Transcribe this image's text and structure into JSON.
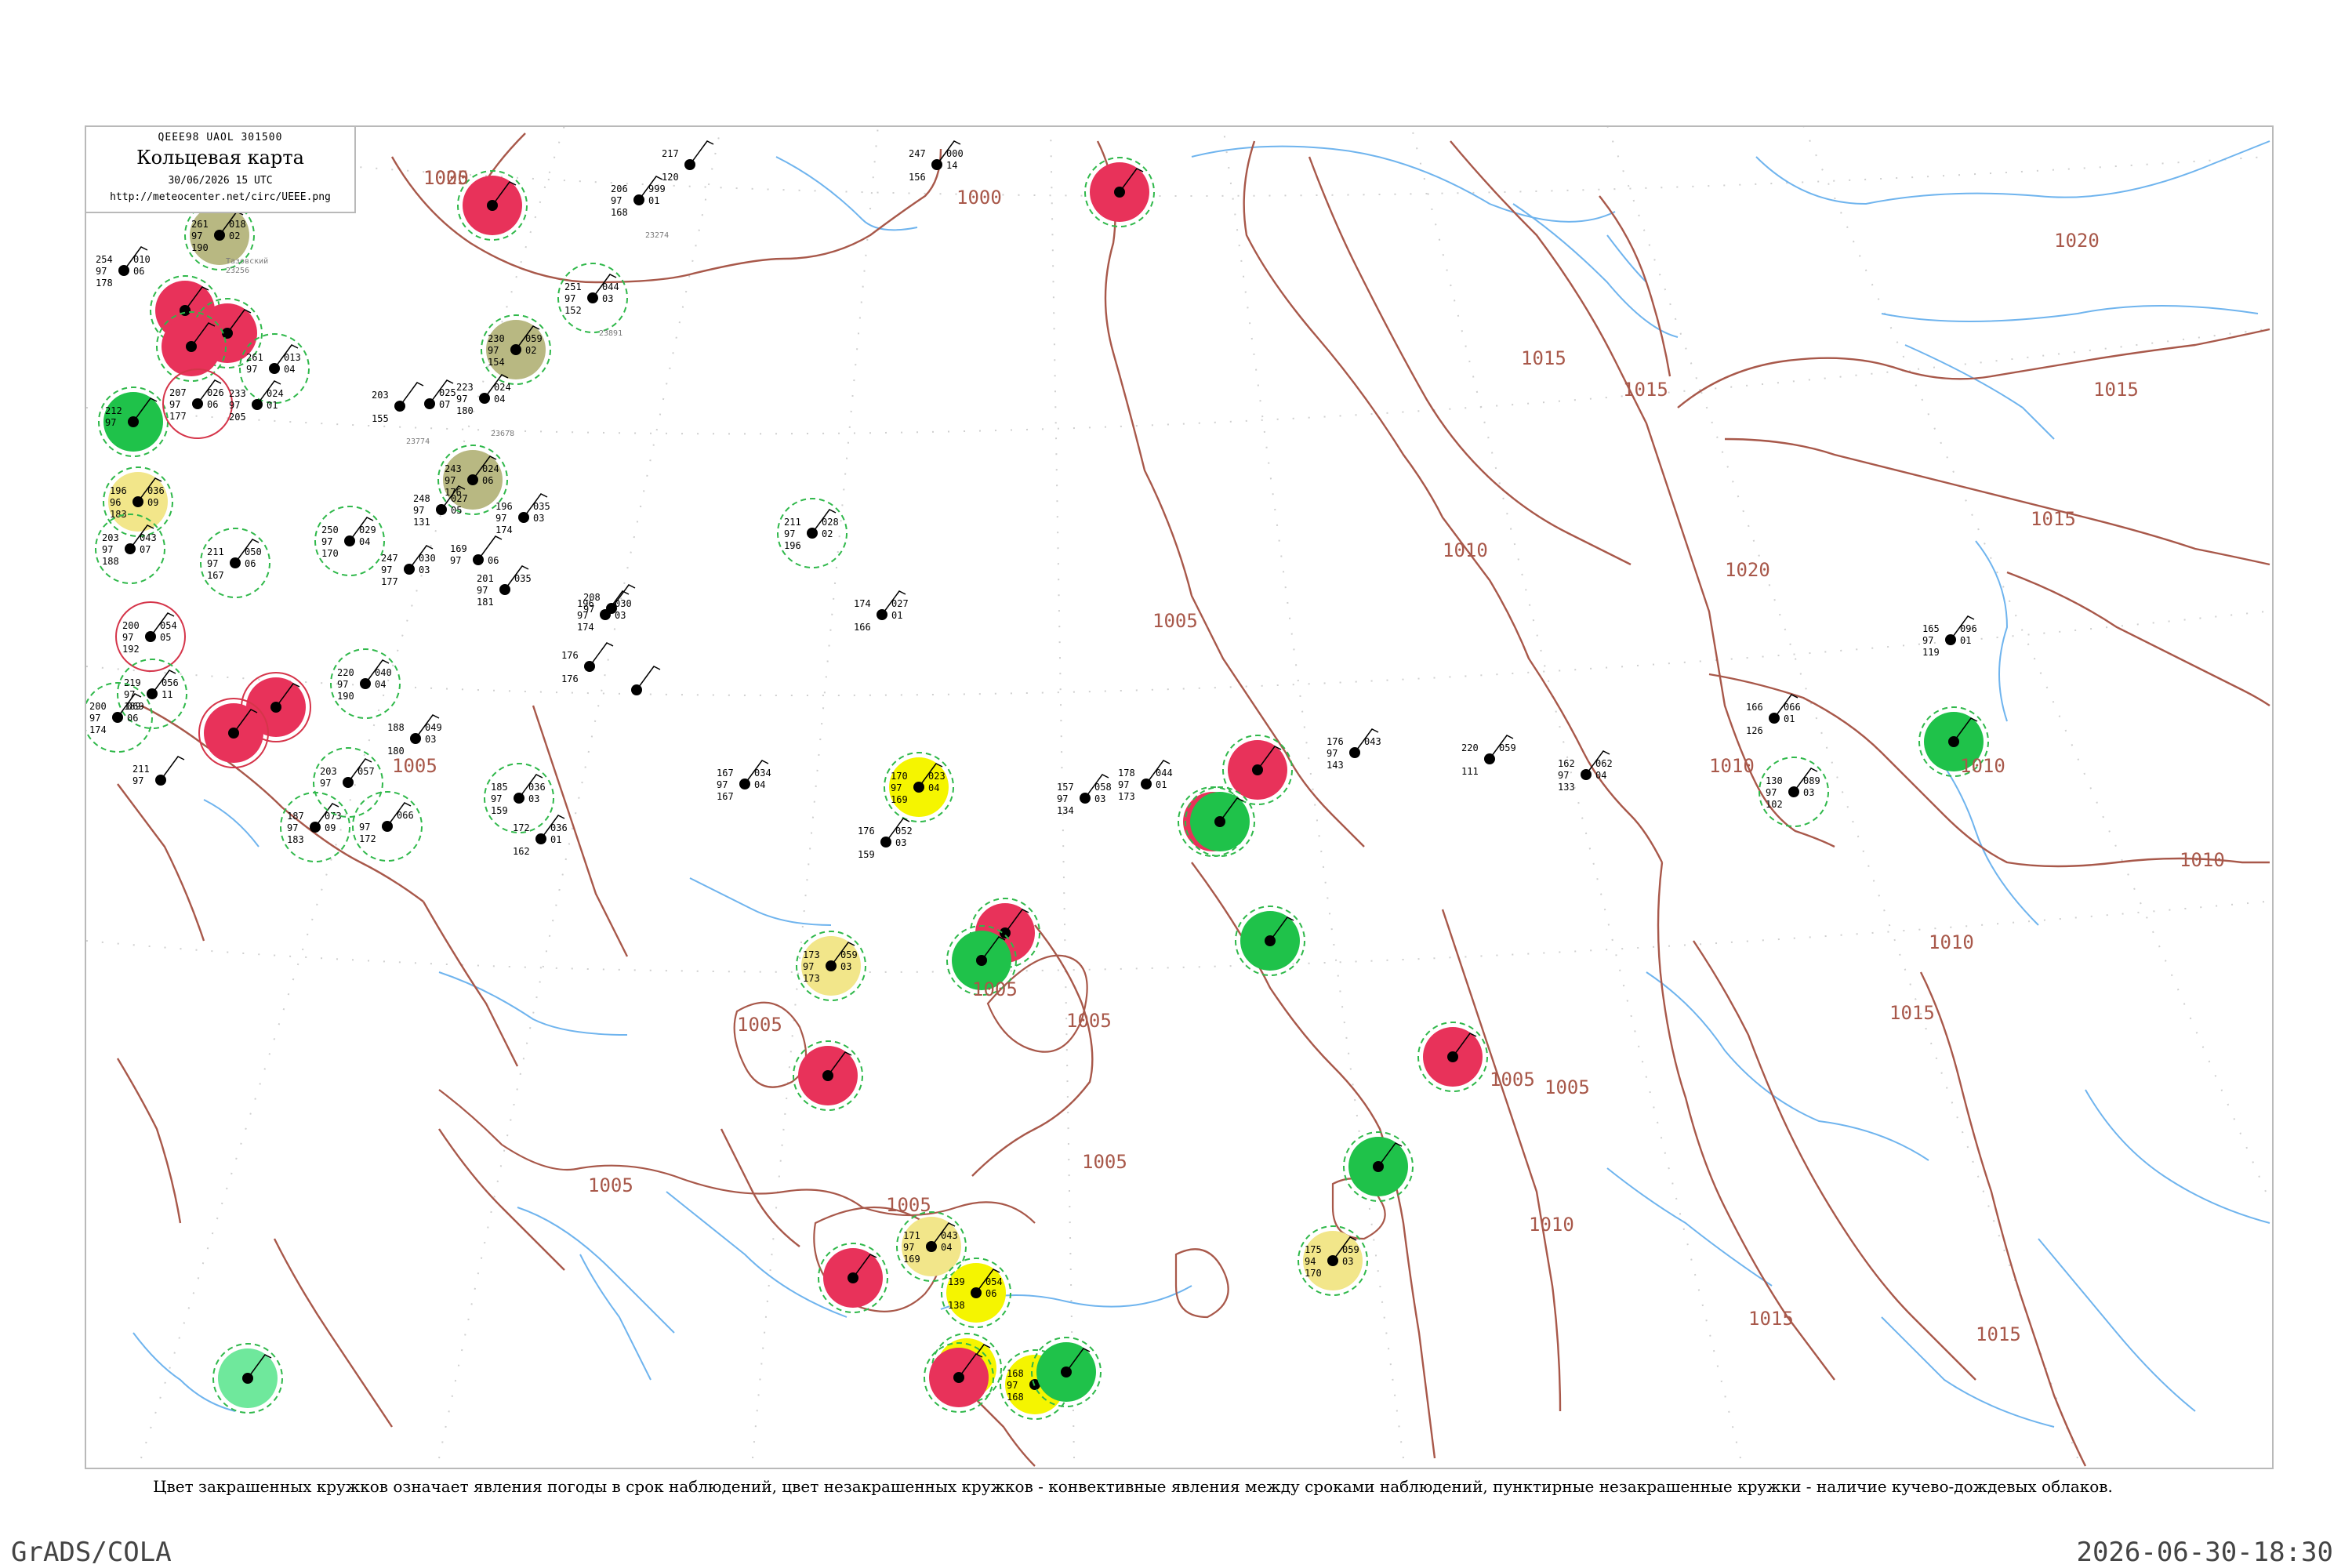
{
  "header": {
    "code": "QEEE98  UAOL  301500",
    "title": "Кольцевая карта",
    "date": "30/06/2026 15 UTC",
    "url": "http://meteocenter.net/circ/UEEE.png"
  },
  "footer": {
    "caption": "Цвет закрашенных кружков означает явления погоды в срок наблюдений, цвет незакрашенных кружков - конвективные явления между сроками наблюдений, пунктирные незакрашенные кружки - наличие кучево-дождевых облаков.",
    "software": "GrADS/COLA",
    "timestamp": "2026-06-30-18:30"
  },
  "colors": {
    "frame": "#b9b9b9",
    "isobar": "#a8584a",
    "river": "#6fb4ee",
    "grid": "#b9b9b9",
    "thunderstorm": "#e8325a",
    "rain": "#1fc24a",
    "shower": "#f5f500",
    "haze": "#b8b882",
    "fog": "#f2e68a",
    "drizzle": "#6fe89c",
    "cb_ring": "#2fb84a",
    "convective_ring": "#d5354a",
    "station_text": "#000000",
    "station_name": "#7a7a7a"
  },
  "isobar_labels": [
    {
      "value": "1000"
    },
    {
      "value": "1000"
    },
    {
      "value": "1005"
    },
    {
      "value": "1005"
    },
    {
      "value": "1005"
    },
    {
      "value": "1005"
    },
    {
      "value": "1005"
    },
    {
      "value": "1005"
    },
    {
      "value": "1005"
    },
    {
      "value": "1005"
    },
    {
      "value": "1005"
    },
    {
      "value": "1005"
    },
    {
      "value": "1010"
    },
    {
      "value": "1010"
    },
    {
      "value": "1010"
    },
    {
      "value": "1010"
    },
    {
      "value": "1010"
    },
    {
      "value": "1010"
    },
    {
      "value": "1015"
    },
    {
      "value": "1015"
    },
    {
      "value": "1015"
    },
    {
      "value": "1015"
    },
    {
      "value": "1015"
    },
    {
      "value": "1015"
    },
    {
      "value": "1015"
    },
    {
      "value": "1020"
    },
    {
      "value": "1020"
    },
    {
      "value": "1025"
    }
  ],
  "stations": [
    {
      "name": "Тазовский",
      "index": "23256",
      "pressure": "261",
      "temp": "97",
      "dew": "190",
      "tendency": "018",
      "change": "02",
      "phenom": "haze",
      "ring": "none"
    },
    {
      "name": "",
      "index": "",
      "pressure": "247",
      "temp": "",
      "dew": "156",
      "tendency": "000",
      "change": "14",
      "phenom": "",
      "ring": "none"
    },
    {
      "name": "",
      "index": "23274",
      "pressure": "206",
      "temp": "97",
      "dew": "168",
      "tendency": "999",
      "change": "01",
      "phenom": "",
      "ring": "none"
    },
    {
      "name": "",
      "index": "",
      "pressure": "217",
      "temp": "",
      "dew": "120",
      "tendency": "",
      "change": "",
      "phenom": "",
      "ring": "none"
    },
    {
      "name": "",
      "index": "",
      "pressure": "",
      "temp": "",
      "dew": "",
      "tendency": "",
      "change": "",
      "phenom": "thunderstorm",
      "ring": "cb"
    },
    {
      "name": "",
      "index": "",
      "pressure": "",
      "temp": "",
      "dew": "",
      "tendency": "",
      "change": "",
      "phenom": "thunderstorm",
      "ring": "cb"
    },
    {
      "name": "",
      "index": "23891",
      "pressure": "251",
      "temp": "97",
      "dew": "152",
      "tendency": "044",
      "change": "03",
      "phenom": "",
      "ring": "cb"
    },
    {
      "name": "",
      "index": "",
      "pressure": "254",
      "temp": "97",
      "dew": "178",
      "tendency": "010",
      "change": "06",
      "phenom": "",
      "ring": "none"
    },
    {
      "name": "",
      "index": "",
      "pressure": "",
      "temp": "",
      "dew": "",
      "tendency": "",
      "change": "",
      "phenom": "thunderstorm",
      "ring": "cb"
    },
    {
      "name": "",
      "index": "",
      "pressure": "",
      "temp": "",
      "dew": "",
      "tendency": "",
      "change": "",
      "phenom": "thunderstorm",
      "ring": "cb"
    },
    {
      "name": "",
      "index": "",
      "pressure": "",
      "temp": "",
      "dew": "",
      "tendency": "",
      "change": "",
      "phenom": "thunderstorm",
      "ring": "cb"
    },
    {
      "name": "",
      "index": "",
      "pressure": "261",
      "temp": "97",
      "dew": "",
      "tendency": "013",
      "change": "04",
      "phenom": "",
      "ring": "cb"
    },
    {
      "name": "",
      "index": "",
      "pressure": "230",
      "temp": "97",
      "dew": "154",
      "tendency": "059",
      "change": "02",
      "phenom": "haze",
      "ring": "cb"
    },
    {
      "name": "",
      "index": "",
      "pressure": "212",
      "temp": "97",
      "dew": "",
      "tendency": "",
      "change": "",
      "phenom": "rain",
      "ring": "cb"
    },
    {
      "name": "",
      "index": "",
      "pressure": "207",
      "temp": "97",
      "dew": "177",
      "tendency": "026",
      "change": "06",
      "phenom": "",
      "ring": "convective"
    },
    {
      "name": "",
      "index": "23774",
      "pressure": "203",
      "temp": "",
      "dew": "155",
      "tendency": "",
      "change": "",
      "phenom": "",
      "ring": "none"
    },
    {
      "name": "",
      "index": "",
      "pressure": "",
      "temp": "",
      "dew": "",
      "tendency": "025",
      "change": "07",
      "phenom": "",
      "ring": "none"
    },
    {
      "name": "",
      "index": "23678",
      "pressure": "223",
      "temp": "97",
      "dew": "180",
      "tendency": "024",
      "change": "04",
      "phenom": "",
      "ring": "none"
    },
    {
      "name": "",
      "index": "",
      "pressure": "233",
      "temp": "97",
      "dew": "205",
      "tendency": "024",
      "change": "01",
      "phenom": "",
      "ring": "none"
    },
    {
      "name": "",
      "index": "",
      "pressure": "243",
      "temp": "97",
      "dew": "176",
      "tendency": "024",
      "change": "06",
      "phenom": "haze",
      "ring": "cb"
    },
    {
      "name": "",
      "index": "",
      "pressure": "196",
      "temp": "96",
      "dew": "183",
      "tendency": "036",
      "change": "09",
      "phenom": "fog",
      "ring": "cb"
    },
    {
      "name": "",
      "index": "",
      "pressure": "203",
      "temp": "97",
      "dew": "188",
      "tendency": "043",
      "change": "07",
      "phenom": "",
      "ring": "cb"
    },
    {
      "name": "",
      "index": "",
      "pressure": "250",
      "temp": "97",
      "dew": "170",
      "tendency": "029",
      "change": "04",
      "phenom": "",
      "ring": "cb"
    },
    {
      "name": "",
      "index": "",
      "pressure": "248",
      "temp": "97",
      "dew": "131",
      "tendency": "027",
      "change": "05",
      "phenom": "",
      "ring": "none"
    },
    {
      "name": "",
      "index": "",
      "pressure": "196",
      "temp": "97",
      "dew": "174",
      "tendency": "035",
      "change": "03",
      "phenom": "",
      "ring": "none"
    },
    {
      "name": "",
      "index": "",
      "pressure": "211",
      "temp": "97",
      "dew": "167",
      "tendency": "050",
      "change": "06",
      "phenom": "",
      "ring": "cb"
    },
    {
      "name": "",
      "index": "",
      "pressure": "247",
      "temp": "97",
      "dew": "177",
      "tendency": "030",
      "change": "03",
      "phenom": "",
      "ring": "none"
    },
    {
      "name": "",
      "index": "",
      "pressure": "169",
      "temp": "97",
      "dew": "",
      "tendency": "",
      "change": "06",
      "phenom": "",
      "ring": "none"
    },
    {
      "name": "",
      "index": "",
      "pressure": "201",
      "temp": "97",
      "dew": "181",
      "tendency": "035",
      "change": "",
      "phenom": "",
      "ring": "none"
    },
    {
      "name": "",
      "index": "",
      "pressure": "208",
      "temp": "97",
      "dew": "",
      "tendency": "",
      "change": "",
      "phenom": "",
      "ring": "none"
    },
    {
      "name": "",
      "index": "",
      "pressure": "200",
      "temp": "97",
      "dew": "192",
      "tendency": "054",
      "change": "05",
      "phenom": "",
      "ring": "convective"
    },
    {
      "name": "",
      "index": "",
      "pressure": "196",
      "temp": "97",
      "dew": "174",
      "tendency": "030",
      "change": "03",
      "phenom": "",
      "ring": "none"
    },
    {
      "name": "",
      "index": "",
      "pressure": "176",
      "temp": "",
      "dew": "176",
      "tendency": "",
      "change": "",
      "phenom": "",
      "ring": "none"
    },
    {
      "name": "",
      "index": "",
      "pressure": "",
      "temp": "",
      "dew": "",
      "tendency": "",
      "change": "",
      "phenom": "",
      "ring": "none"
    },
    {
      "name": "",
      "index": "",
      "pressure": "219",
      "temp": "97",
      "dew": "189",
      "tendency": "056",
      "change": "11",
      "phenom": "",
      "ring": "cb"
    },
    {
      "name": "",
      "index": "",
      "pressure": "220",
      "temp": "97",
      "dew": "190",
      "tendency": "040",
      "change": "04",
      "phenom": "",
      "ring": "cb"
    },
    {
      "name": "",
      "index": "",
      "pressure": "",
      "temp": "",
      "dew": "",
      "tendency": "",
      "change": "",
      "phenom": "thunderstorm",
      "ring": "convective"
    },
    {
      "name": "",
      "index": "",
      "pressure": "",
      "temp": "",
      "dew": "",
      "tendency": "",
      "change": "",
      "phenom": "thunderstorm",
      "ring": "convective"
    },
    {
      "name": "",
      "index": "",
      "pressure": "200",
      "temp": "97",
      "dew": "174",
      "tendency": "069",
      "change": "06",
      "phenom": "",
      "ring": "cb"
    },
    {
      "name": "",
      "index": "",
      "pressure": "211",
      "temp": "97",
      "dew": "",
      "tendency": "",
      "change": "",
      "phenom": "",
      "ring": "none"
    },
    {
      "name": "",
      "index": "",
      "pressure": "187",
      "temp": "97",
      "dew": "183",
      "tendency": "073",
      "change": "09",
      "phenom": "",
      "ring": "cb"
    },
    {
      "name": "",
      "index": "",
      "pressure": "",
      "temp": "97",
      "dew": "172",
      "tendency": "066",
      "change": "",
      "phenom": "",
      "ring": "cb"
    },
    {
      "name": "",
      "index": "",
      "pressure": "203",
      "temp": "97",
      "dew": "",
      "tendency": "057",
      "change": "",
      "phenom": "",
      "ring": "cb"
    },
    {
      "name": "",
      "index": "",
      "pressure": "188",
      "temp": "",
      "dew": "180",
      "tendency": "049",
      "change": "03",
      "phenom": "",
      "ring": "none"
    },
    {
      "name": "",
      "index": "",
      "pressure": "185",
      "temp": "97",
      "dew": "159",
      "tendency": "036",
      "change": "03",
      "phenom": "",
      "ring": "cb"
    },
    {
      "name": "",
      "index": "",
      "pressure": "172",
      "temp": "",
      "dew": "162",
      "tendency": "036",
      "change": "01",
      "phenom": "",
      "ring": "none"
    },
    {
      "name": "",
      "index": "",
      "pressure": "167",
      "temp": "97",
      "dew": "167",
      "tendency": "034",
      "change": "04",
      "phenom": "",
      "ring": "none"
    },
    {
      "name": "",
      "index": "",
      "pressure": "211",
      "temp": "97",
      "dew": "196",
      "tendency": "028",
      "change": "02",
      "phenom": "",
      "ring": "cb"
    },
    {
      "name": "",
      "index": "",
      "pressure": "174",
      "temp": "",
      "dew": "166",
      "tendency": "027",
      "change": "01",
      "phenom": "",
      "ring": "none"
    },
    {
      "name": "",
      "index": "",
      "pressure": "170",
      "temp": "97",
      "dew": "169",
      "tendency": "023",
      "change": "04",
      "phenom": "shower",
      "ring": "none"
    },
    {
      "name": "",
      "index": "",
      "pressure": "176",
      "temp": "",
      "dew": "159",
      "tendency": "052",
      "change": "03",
      "phenom": "",
      "ring": "none"
    },
    {
      "name": "",
      "index": "",
      "pressure": "157",
      "temp": "97",
      "dew": "134",
      "tendency": "058",
      "change": "03",
      "phenom": "",
      "ring": "none"
    },
    {
      "name": "",
      "index": "",
      "pressure": "178",
      "temp": "97",
      "dew": "173",
      "tendency": "044",
      "change": "01",
      "phenom": "",
      "ring": "none"
    },
    {
      "name": "",
      "index": "",
      "pressure": "",
      "temp": "",
      "dew": "",
      "tendency": "",
      "change": "",
      "phenom": "thunderstorm",
      "ring": "cb"
    },
    {
      "name": "",
      "index": "",
      "pressure": "",
      "temp": "",
      "dew": "",
      "tendency": "",
      "change": "",
      "phenom": "thunderstorm",
      "ring": "cb"
    },
    {
      "name": "",
      "index": "",
      "pressure": "176",
      "temp": "97",
      "dew": "143",
      "tendency": "043",
      "change": "",
      "phenom": "",
      "ring": "none"
    },
    {
      "name": "",
      "index": "",
      "pressure": "220",
      "temp": "",
      "dew": "111",
      "tendency": "059",
      "change": "",
      "phenom": "",
      "ring": "none"
    },
    {
      "name": "",
      "index": "",
      "pressure": "162",
      "temp": "97",
      "dew": "133",
      "tendency": "062",
      "change": "04",
      "phenom": "",
      "ring": "none"
    },
    {
      "name": "",
      "index": "",
      "pressure": "166",
      "temp": "",
      "dew": "126",
      "tendency": "066",
      "change": "01",
      "phenom": "",
      "ring": "none"
    },
    {
      "name": "",
      "index": "",
      "pressure": "130",
      "temp": "97",
      "dew": "102",
      "tendency": "089",
      "change": "03",
      "phenom": "",
      "ring": "cb"
    },
    {
      "name": "",
      "index": "",
      "pressure": "165",
      "temp": "97",
      "dew": "119",
      "tendency": "096",
      "change": "01",
      "phenom": "",
      "ring": "none"
    },
    {
      "name": "",
      "index": "",
      "pressure": "",
      "temp": "",
      "dew": "",
      "tendency": "",
      "change": "",
      "phenom": "rain",
      "ring": "cb"
    },
    {
      "name": "",
      "index": "",
      "pressure": "",
      "temp": "",
      "dew": "",
      "tendency": "",
      "change": "",
      "phenom": "rain",
      "ring": "cb"
    },
    {
      "name": "",
      "index": "",
      "pressure": "",
      "temp": "",
      "dew": "",
      "tendency": "",
      "change": "",
      "phenom": "thunderstorm",
      "ring": "cb"
    },
    {
      "name": "",
      "index": "",
      "pressure": "",
      "temp": "",
      "dew": "",
      "tendency": "",
      "change": "",
      "phenom": "rain",
      "ring": "cb"
    },
    {
      "name": "",
      "index": "",
      "pressure": "",
      "temp": "",
      "dew": "",
      "tendency": "",
      "change": "",
      "phenom": "thunderstorm",
      "ring": "cb"
    },
    {
      "name": "",
      "index": "",
      "pressure": "173",
      "temp": "97",
      "dew": "173",
      "tendency": "059",
      "change": "03",
      "phenom": "fog",
      "ring": "cb"
    },
    {
      "name": "",
      "index": "",
      "pressure": "",
      "temp": "",
      "dew": "",
      "tendency": "",
      "change": "",
      "phenom": "rain",
      "ring": "cb"
    },
    {
      "name": "",
      "index": "",
      "pressure": "",
      "temp": "",
      "dew": "",
      "tendency": "",
      "change": "",
      "phenom": "rain",
      "ring": "cb"
    },
    {
      "name": "",
      "index": "",
      "pressure": "",
      "temp": "",
      "dew": "",
      "tendency": "",
      "change": "",
      "phenom": "thunderstorm",
      "ring": "cb"
    },
    {
      "name": "",
      "index": "",
      "pressure": "",
      "temp": "",
      "dew": "",
      "tendency": "",
      "change": "",
      "phenom": "thunderstorm",
      "ring": "cb"
    },
    {
      "name": "",
      "index": "",
      "pressure": "171",
      "temp": "97",
      "dew": "169",
      "tendency": "043",
      "change": "04",
      "phenom": "fog",
      "ring": "cb"
    },
    {
      "name": "",
      "index": "",
      "pressure": "",
      "temp": "",
      "dew": "",
      "tendency": "",
      "change": "",
      "phenom": "shower",
      "ring": "none"
    },
    {
      "name": "",
      "index": "",
      "pressure": "168",
      "temp": "97",
      "dew": "168",
      "tendency": "046",
      "change": "01",
      "phenom": "shower",
      "ring": "none"
    },
    {
      "name": "",
      "index": "",
      "pressure": "139",
      "temp": "",
      "dew": "138",
      "tendency": "054",
      "change": "06",
      "phenom": "shower",
      "ring": "none"
    },
    {
      "name": "",
      "index": "",
      "pressure": "",
      "temp": "",
      "dew": "",
      "tendency": "",
      "change": "",
      "phenom": "rain",
      "ring": "cb"
    },
    {
      "name": "",
      "index": "",
      "pressure": "",
      "temp": "",
      "dew": "",
      "tendency": "",
      "change": "",
      "phenom": "drizzle",
      "ring": "none"
    },
    {
      "name": "",
      "index": "",
      "pressure": "",
      "temp": "",
      "dew": "",
      "tendency": "",
      "change": "",
      "phenom": "thunderstorm",
      "ring": "cb"
    },
    {
      "name": "",
      "index": "",
      "pressure": "175",
      "temp": "94",
      "dew": "170",
      "tendency": "059",
      "change": "03",
      "phenom": "fog",
      "ring": "cb"
    }
  ]
}
